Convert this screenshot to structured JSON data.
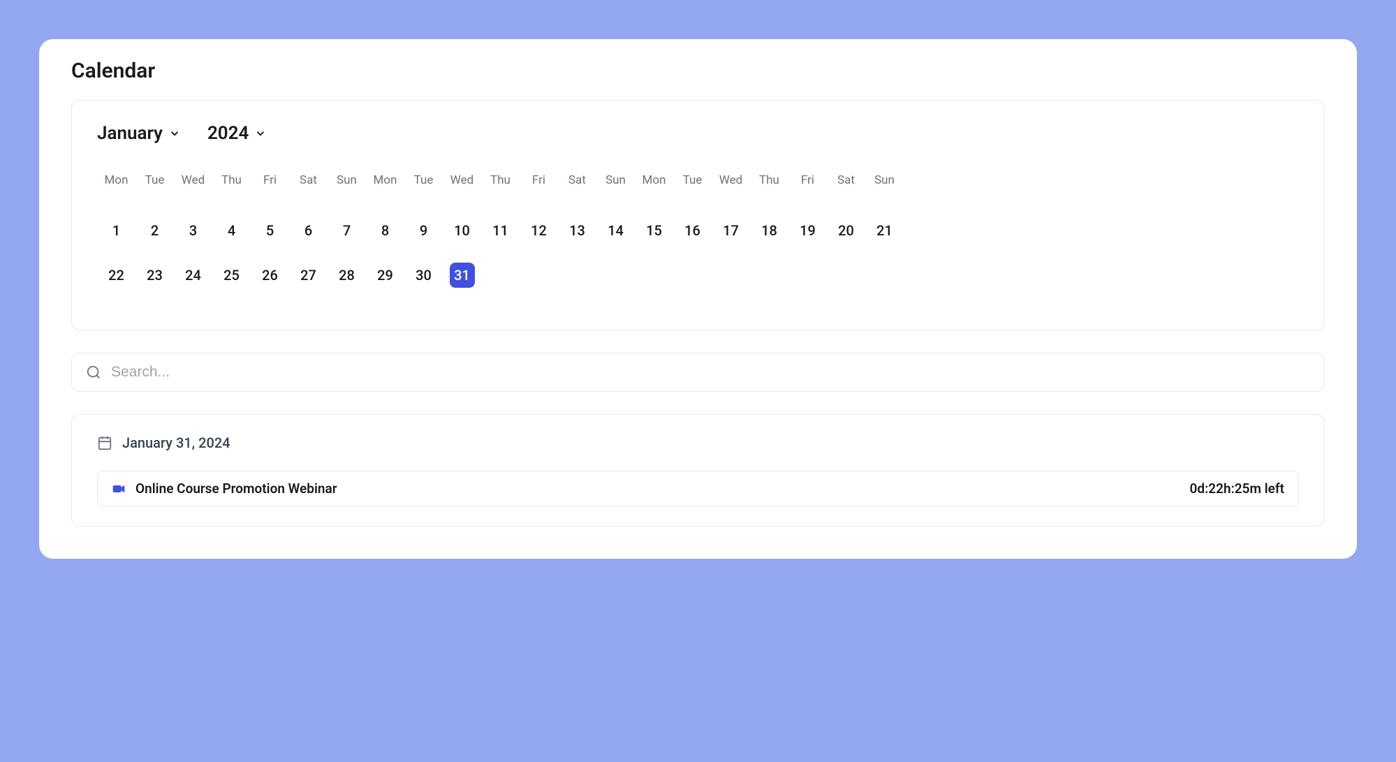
{
  "page": {
    "title": "Calendar"
  },
  "calendar": {
    "month": "January",
    "year": "2024",
    "day_headers": [
      "Mon",
      "Tue",
      "Wed",
      "Thu",
      "Fri",
      "Sat",
      "Sun",
      "Mon",
      "Tue",
      "Wed",
      "Thu",
      "Fri",
      "Sat",
      "Sun",
      "Mon",
      "Tue",
      "Wed",
      "Thu",
      "Fri",
      "Sat",
      "Sun"
    ],
    "row1": [
      "1",
      "2",
      "3",
      "4",
      "5",
      "6",
      "7",
      "8",
      "9",
      "10",
      "11",
      "12",
      "13",
      "14",
      "15",
      "16",
      "17",
      "18",
      "19",
      "20",
      "21"
    ],
    "row2": [
      "22",
      "23",
      "24",
      "25",
      "26",
      "27",
      "28",
      "29",
      "30",
      "31",
      "",
      "",
      "",
      "",
      "",
      "",
      "",
      "",
      "",
      "",
      ""
    ],
    "selected_day": "31"
  },
  "search": {
    "placeholder": "Search..."
  },
  "event_section": {
    "date": "January 31, 2024",
    "items": [
      {
        "title": "Online Course Promotion Webinar",
        "time_left": "0d:22h:25m left"
      }
    ]
  },
  "colors": {
    "accent": "#4051db",
    "background": "#94a8f2"
  }
}
